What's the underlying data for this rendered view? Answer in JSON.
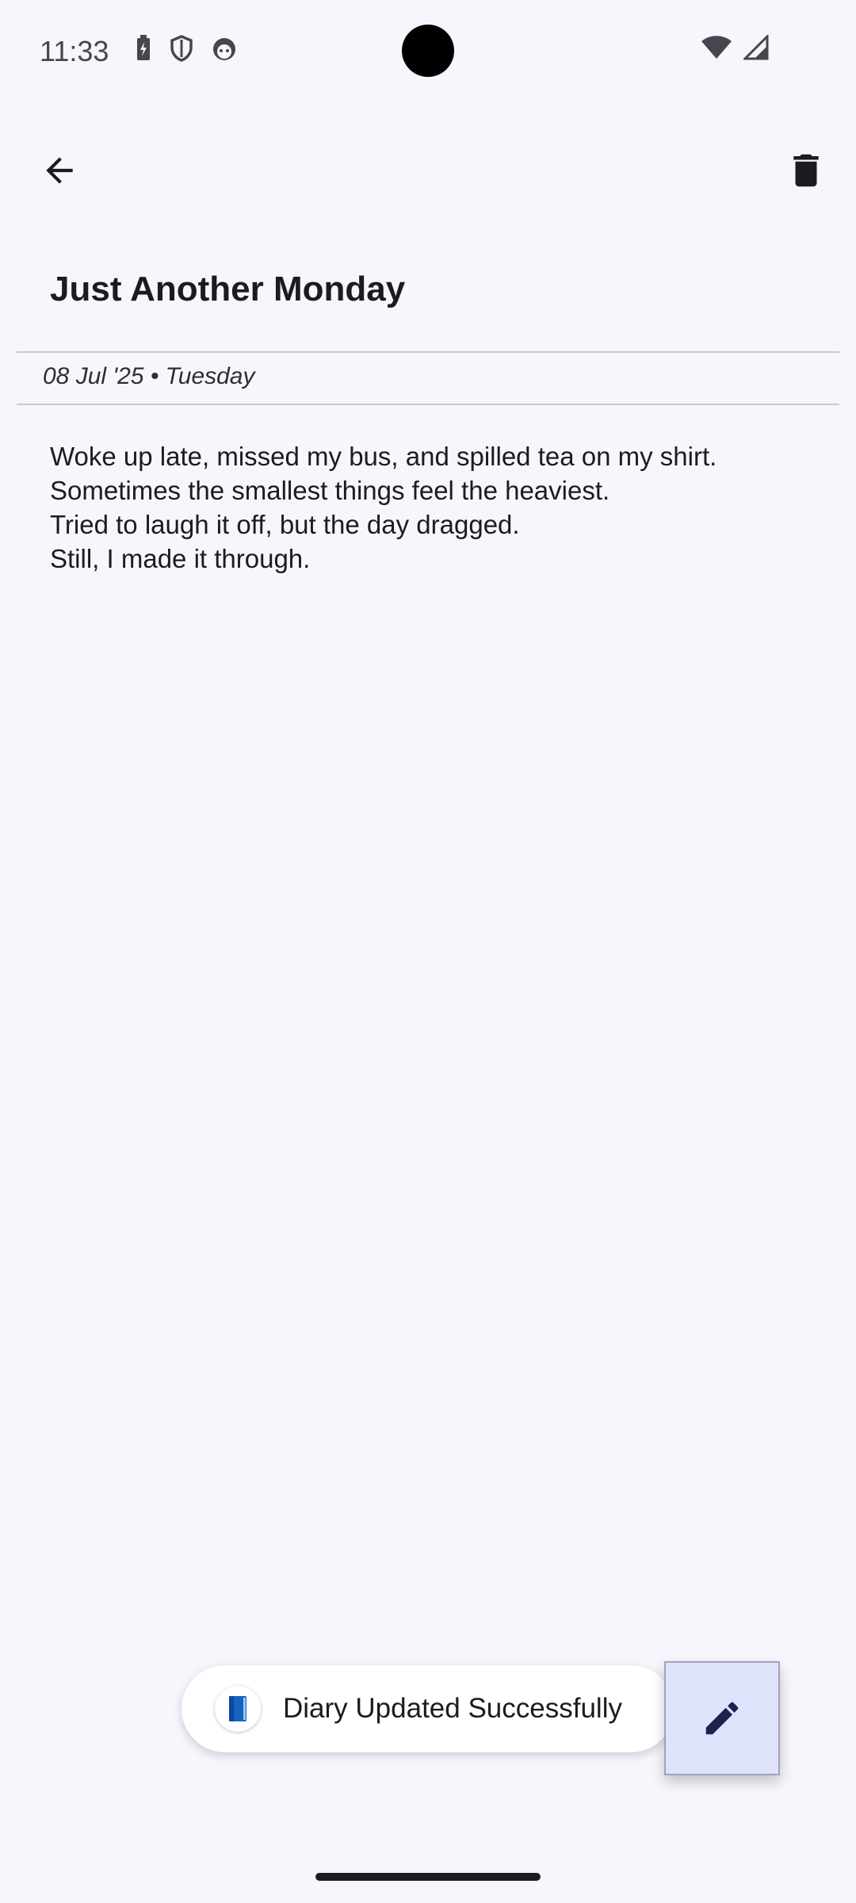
{
  "status_bar": {
    "time": "11:33",
    "left_icons": [
      "battery-saver-icon",
      "shield-icon",
      "android-face-icon"
    ],
    "right_icons": [
      "wifi-icon",
      "cell-signal-icon"
    ]
  },
  "top_bar": {
    "back_icon": "arrow-back-icon",
    "delete_icon": "trash-icon"
  },
  "entry": {
    "title": "Just Another Monday",
    "date": "08 Jul '25 • Tuesday",
    "body_lines": [
      "Woke up late, missed my bus, and spilled tea on my shirt.",
      "Sometimes the smallest things feel the heaviest.",
      "Tried to laugh it off, but the day dragged.",
      "Still, I made it through."
    ]
  },
  "snackbar": {
    "icon": "book-icon",
    "message": "Diary Updated Successfully"
  },
  "fab": {
    "icon": "pencil-icon"
  },
  "colors": {
    "background": "#f7f6fd",
    "fab_background": "#dfe2fb",
    "fab_icon": "#1a2350",
    "book_icon": "#1565c0"
  }
}
